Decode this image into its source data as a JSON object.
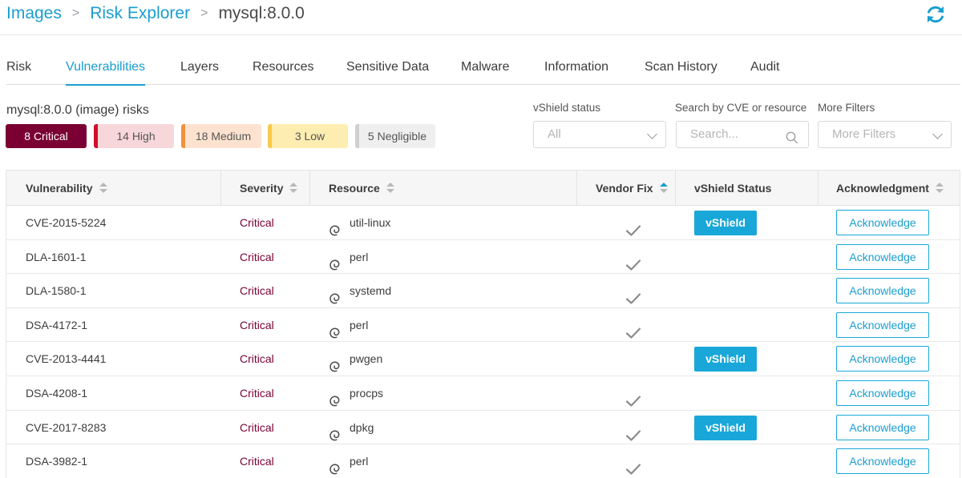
{
  "breadcrumb": {
    "items": [
      "Images",
      "Risk Explorer"
    ],
    "current": "mysql:8.0.0",
    "separator": ">"
  },
  "tabs": [
    "Risk",
    "Vulnerabilities",
    "Layers",
    "Resources",
    "Sensitive Data",
    "Malware",
    "Information",
    "Scan History",
    "Audit"
  ],
  "active_tab": "Vulnerabilities",
  "summary": {
    "title": "mysql:8.0.0 (image) risks",
    "badges": {
      "critical": "8 Critical",
      "high": "14 High",
      "medium": "18 Medium",
      "low": "3 Low",
      "negligible": "5 Negligible"
    }
  },
  "filters": {
    "vshield_label": "vShield status",
    "vshield_value": "All",
    "search_label": "Search by CVE or resource",
    "search_placeholder": "Search...",
    "more_label": "More Filters",
    "more_value": "More Filters"
  },
  "table": {
    "headers": {
      "vulnerability": "Vulnerability",
      "severity": "Severity",
      "resource": "Resource",
      "vendor_fix": "Vendor Fix",
      "vshield_status": "vShield Status",
      "acknowledgment": "Acknowledgment"
    },
    "vshield_button": "vShield",
    "ack_button": "Acknowledge",
    "rows": [
      {
        "id": "CVE-2015-5224",
        "severity": "Critical",
        "resource": "util-linux",
        "vendor_fix": true,
        "vshield": true
      },
      {
        "id": "DLA-1601-1",
        "severity": "Critical",
        "resource": "perl",
        "vendor_fix": true,
        "vshield": false
      },
      {
        "id": "DLA-1580-1",
        "severity": "Critical",
        "resource": "systemd",
        "vendor_fix": true,
        "vshield": false
      },
      {
        "id": "DSA-4172-1",
        "severity": "Critical",
        "resource": "perl",
        "vendor_fix": true,
        "vshield": false
      },
      {
        "id": "CVE-2013-4441",
        "severity": "Critical",
        "resource": "pwgen",
        "vendor_fix": false,
        "vshield": true
      },
      {
        "id": "DSA-4208-1",
        "severity": "Critical",
        "resource": "procps",
        "vendor_fix": true,
        "vshield": false
      },
      {
        "id": "CVE-2017-8283",
        "severity": "Critical",
        "resource": "dpkg",
        "vendor_fix": true,
        "vshield": true
      },
      {
        "id": "DSA-3982-1",
        "severity": "Critical",
        "resource": "perl",
        "vendor_fix": true,
        "vshield": false
      }
    ]
  },
  "colors": {
    "accent": "#1a9ecf",
    "critical": "#7a0033",
    "high": "#d0102a",
    "medium": "#f2913c",
    "low": "#f7c948",
    "vshield_button": "#19a7d9"
  },
  "icons": {
    "refresh": "refresh-icon",
    "resource": "debian-swirl-icon",
    "vendor_fix": "checkmark-icon",
    "search": "search-icon",
    "dropdown": "chevron-down-icon"
  }
}
